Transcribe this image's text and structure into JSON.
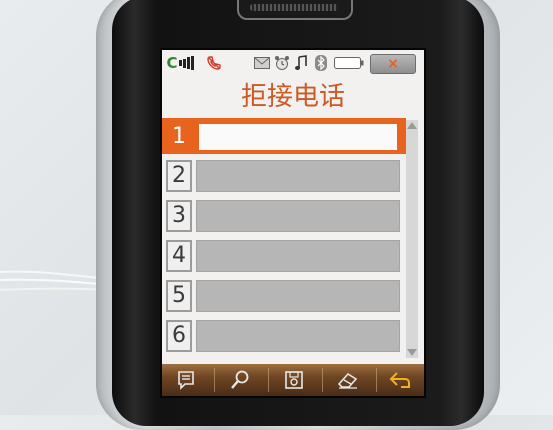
{
  "screen": {
    "title": "拒接电话",
    "status": {
      "network_letter": "C",
      "icons": [
        "signal-bars-icon",
        "missed-call-icon",
        "mail-icon",
        "alarm-icon",
        "music-note-icon",
        "bluetooth-icon",
        "battery-icon"
      ]
    },
    "close_label": "×",
    "rows": [
      {
        "index": "1",
        "value": "",
        "selected": true
      },
      {
        "index": "2",
        "value": ""
      },
      {
        "index": "3",
        "value": ""
      },
      {
        "index": "4",
        "value": ""
      },
      {
        "index": "5",
        "value": ""
      },
      {
        "index": "6",
        "value": ""
      }
    ],
    "toolbar": [
      "options-icon",
      "search-icon",
      "save-icon",
      "erase-icon",
      "back-icon"
    ],
    "colors": {
      "accent": "#e8641e",
      "toolbar": "#6e4624",
      "signal_green": "#2f8a2f"
    }
  }
}
